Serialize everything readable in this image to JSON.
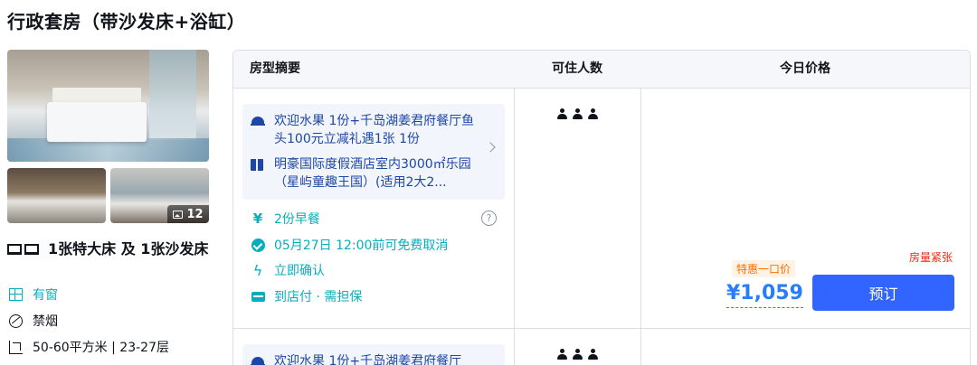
{
  "room": {
    "title": "行政套房（带沙发床+浴缸）",
    "photo_count": "12",
    "bed": "1张特大床 及 1张沙发床",
    "features": [
      {
        "icon": "window-icon",
        "label": "有窗"
      },
      {
        "icon": "no-smoking-icon",
        "label": "禁烟"
      },
      {
        "icon": "area-icon",
        "label": "50-60平方米 | 23-27层"
      }
    ]
  },
  "table": {
    "headers": {
      "summary": "房型摘要",
      "guests": "可住人数",
      "price": "今日价格"
    },
    "rows": [
      {
        "promos": [
          {
            "icon": "dining-dome-icon",
            "text": "欢迎水果 1份+千岛湖姜君府餐厅鱼头100元立减礼遇1张 1份"
          },
          {
            "icon": "gift-icon",
            "text": "明豪国际度假酒店室内3000㎡乐园（星屿童趣王国）(适用2大2..."
          }
        ],
        "perks": [
          {
            "icon": "fork-knife-icon",
            "text": "2份早餐"
          },
          {
            "icon": "check-circle-icon",
            "text": "05月27日 12:00前可免费取消"
          },
          {
            "icon": "lightning-icon",
            "text": "立即确认"
          },
          {
            "icon": "card-icon",
            "text": "到店付 · 需担保"
          }
        ],
        "help_glyph": "?",
        "guests": 3,
        "scarcity": "房量紧张",
        "deal_tag": "特惠一口价",
        "price": "¥1,059",
        "book_label": "预订"
      },
      {
        "promo": "欢迎水果 1份+千岛湖姜君府餐厅",
        "guests": 3
      }
    ]
  },
  "colors": {
    "accent": "#287dfa",
    "button": "#3264ff",
    "teal": "#06aebd",
    "promo_text": "#1d46a8",
    "warning": "#f2270c",
    "deal": "#ff6f00"
  }
}
